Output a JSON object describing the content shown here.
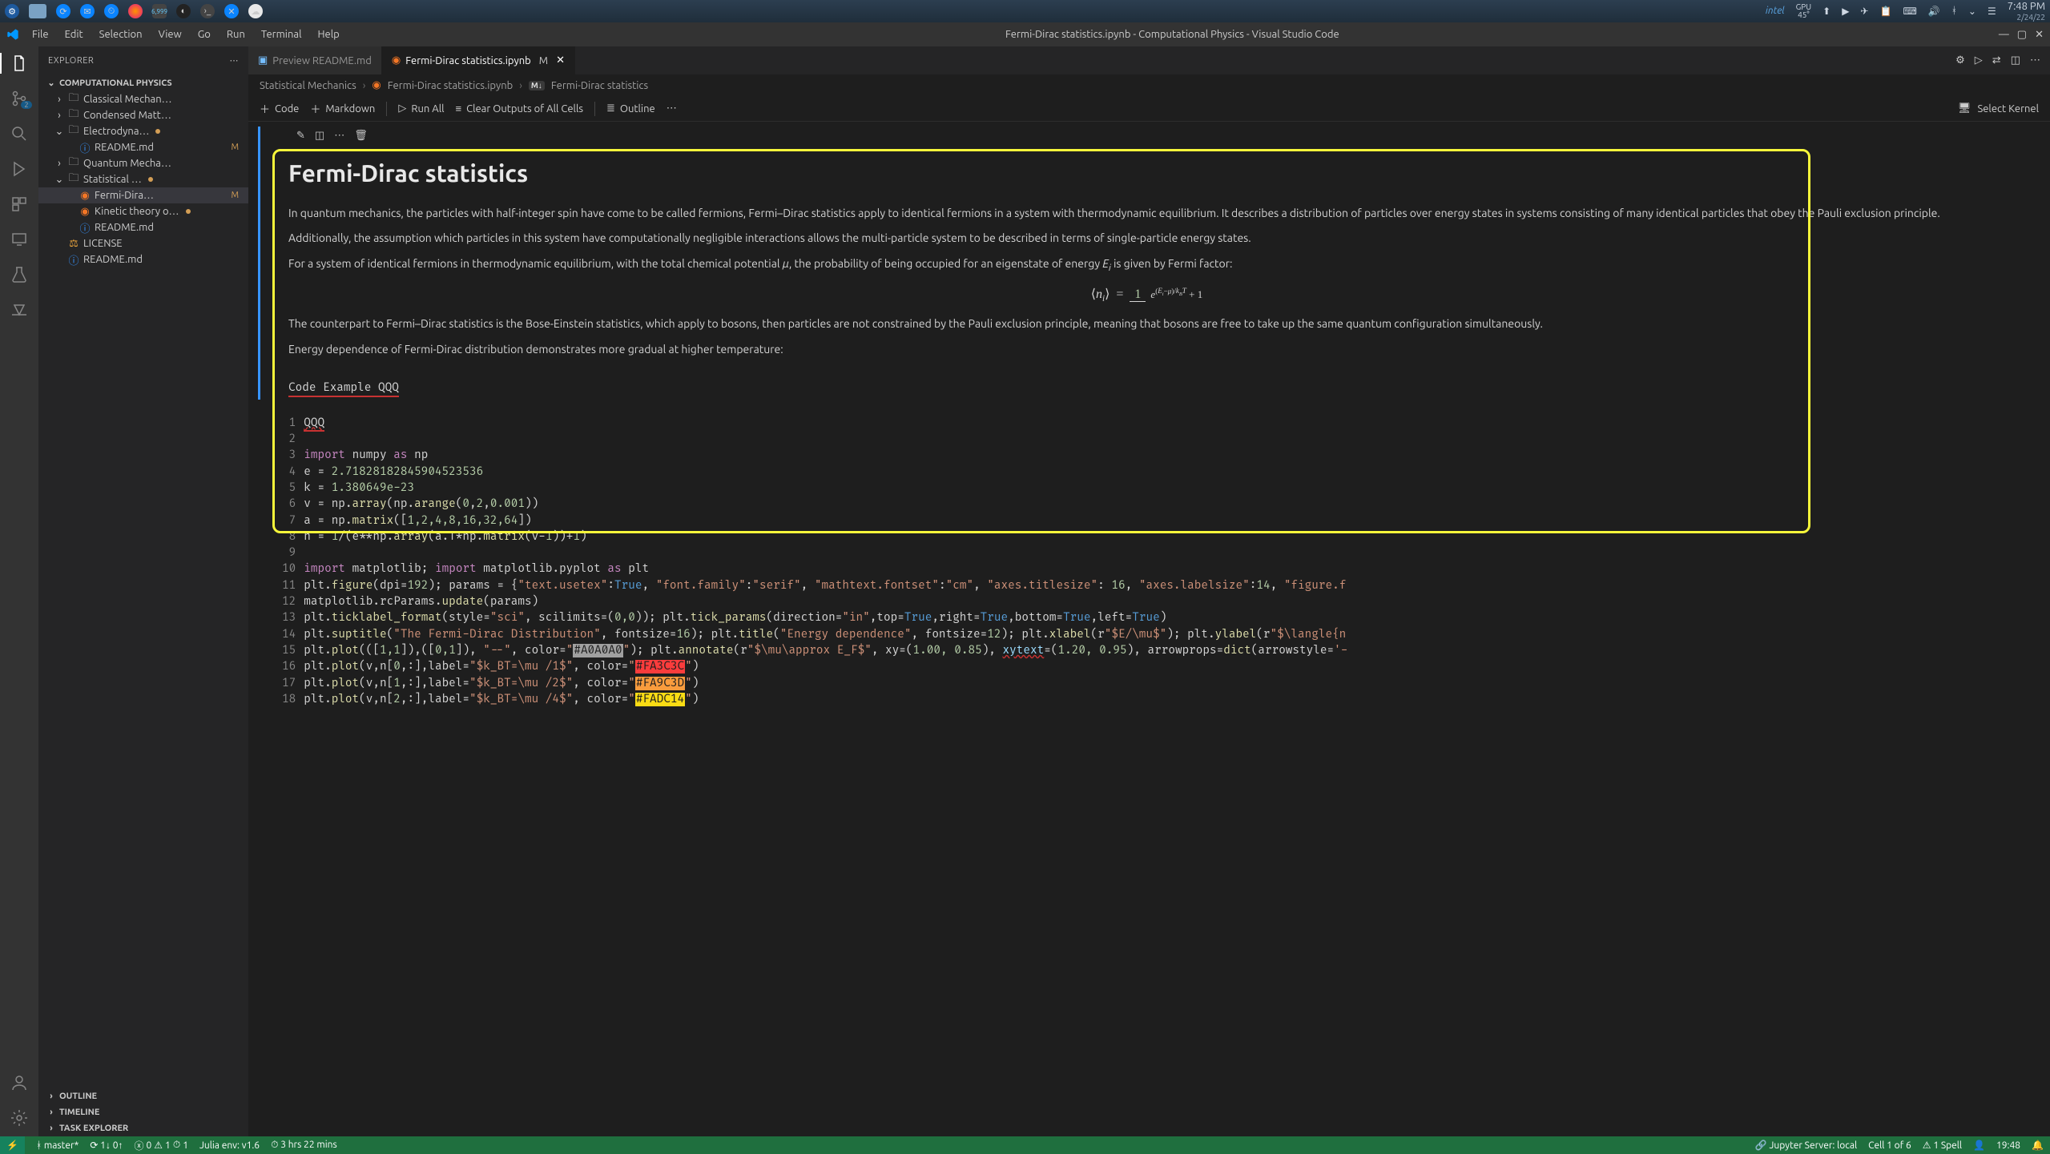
{
  "taskbar": {
    "gpu_label": "GPU",
    "gpu_temp": "45°",
    "intel": "intel",
    "time": "7:48 PM",
    "date": "2/24/22"
  },
  "titlebar": {
    "menus": [
      "File",
      "Edit",
      "Selection",
      "View",
      "Go",
      "Run",
      "Terminal",
      "Help"
    ],
    "title": "Fermi-Dirac statistics.ipynb - Computational Physics - Visual Studio Code"
  },
  "explorer": {
    "header": "EXPLORER",
    "project": "COMPUTATIONAL PHYSICS",
    "tree": [
      {
        "indent": 1,
        "type": "folder",
        "chev": "›",
        "name": "Classical Mechan…",
        "st": ""
      },
      {
        "indent": 1,
        "type": "folder",
        "chev": "›",
        "name": "Condensed Matt…",
        "st": ""
      },
      {
        "indent": 1,
        "type": "folder",
        "chev": "⌄",
        "name": "Electrodyna…",
        "st": "",
        "dot": true
      },
      {
        "indent": 2,
        "type": "info",
        "name": "README.md",
        "st": "M"
      },
      {
        "indent": 1,
        "type": "folder",
        "chev": "›",
        "name": "Quantum Mecha…",
        "st": ""
      },
      {
        "indent": 1,
        "type": "folder",
        "chev": "⌄",
        "name": "Statistical …",
        "st": "",
        "dot": true
      },
      {
        "indent": 2,
        "type": "jup",
        "name": "Fermi-Dira…",
        "st": "M",
        "sel": true
      },
      {
        "indent": 2,
        "type": "jup",
        "name": "Kinetic theory o…",
        "st": "",
        "dot": true
      },
      {
        "indent": 2,
        "type": "info",
        "name": "README.md",
        "st": ""
      },
      {
        "indent": 1,
        "type": "lic",
        "name": "LICENSE",
        "st": ""
      },
      {
        "indent": 1,
        "type": "info",
        "name": "README.md",
        "st": ""
      }
    ],
    "sections": [
      "OUTLINE",
      "TIMELINE",
      "TASK EXPLORER"
    ]
  },
  "tabs": [
    {
      "icon": "preview",
      "label": "Preview README.md",
      "active": false
    },
    {
      "icon": "jupyter",
      "label": "Fermi-Dirac statistics.ipynb",
      "mod": "M",
      "active": true,
      "close": true
    }
  ],
  "tab_actions": {},
  "breadcrumbs": {
    "folder": "Statistical Mechanics",
    "file": "Fermi-Dirac statistics.ipynb",
    "symtag": "M↓",
    "symbol": "Fermi-Dirac statistics"
  },
  "nb_toolbar": {
    "code": "Code",
    "markdown": "Markdown",
    "runall": "Run All",
    "clear": "Clear Outputs of All Cells",
    "outline": "Outline",
    "kernel": "Select Kernel"
  },
  "md": {
    "title": "Fermi-Dirac statistics",
    "p1": "In quantum mechanics, the particles with half-integer spin have come to be called fermions, Fermi–Dirac statistics apply to identical fermions in a system with thermodynamic equilibrium. It describes a distribution of particles over energy states in systems consisting of many identical particles that obey the Pauli exclusion principle.",
    "p2": "Additionally, the assumption which particles in this system have computationally negligible interactions allows the multi-particle system to be described in terms of single-particle energy states.",
    "p3a": "For a system of identical fermions in thermodynamic equilibrium, with the total chemical potential ",
    "p3b": ", the probability of being occupied for an eigenstate of energy ",
    "p3c": " is given by Fermi factor:",
    "p4": "The counterpart to Fermi–Dirac statistics is the Bose-Einstein statistics, which apply to bosons, then particles are not constrained by the Pauli exclusion principle, meaning that bosons are free to take up the same quantum configuration simultaneously.",
    "p5": "Energy dependence of Fermi-Dirac distribution demonstrates more gradual at higher temperature:",
    "code_label": "Code Example QQQ"
  },
  "code": {
    "lines": 18,
    "l1": "QQQ",
    "l3_import": "import",
    "l3_as": "as",
    "l3_numpy": "numpy",
    "l3_np": "np",
    "l4": "e = ",
    "l4v": "2.71828182845904523536",
    "l5": "k = ",
    "l5v": "1.380649e-23",
    "l6": "v = np.",
    "l6fn": "array",
    "l6a": "(np.",
    "l6fn2": "arange",
    "l6b": "(",
    "l6n1": "0",
    "l6n2": "2",
    "l6n3": "0.001",
    "l6c": "))",
    "l7": "a = np.",
    "l7fn": "matrix",
    "l7a": "([",
    "l7n": "1,2,4,8,16,32,64",
    "l7b": "])",
    "l8": "n = ",
    "l8a": "1",
    "l8b": "/(e**np.",
    "l8fn": "array",
    "l8c": "(a.T*np.",
    "l8fn2": "matrix",
    "l8d": "(v-",
    "l8n": "1",
    "l8e": "))+",
    "l8n2": "1",
    "l8f": ")",
    "l10a": "import",
    "l10b": "matplotlib;",
    "l10c": "import",
    "l10d": "matplotlib.pyplot",
    "l10e": "as",
    "l10f": "plt",
    "l11": "plt.",
    "l11fn": "figure",
    "l11a": "(dpi=",
    "l11n": "192",
    "l11b": "); params = {",
    "l11s1": "\"text.usetex\"",
    "l11c": ":",
    "l11t": "True",
    "l11d": ", ",
    "l11s2": "\"font.family\"",
    "l11e": ":",
    "l11s3": "\"serif\"",
    "l11f": ", ",
    "l11s4": "\"mathtext.fontset\"",
    "l11g": ":",
    "l11s5": "\"cm\"",
    "l11h": ", ",
    "l11s6": "\"axes.titlesize\"",
    "l11i": ": ",
    "l11n2": "16",
    "l11j": ", ",
    "l11s7": "\"axes.labelsize\"",
    "l11k": ":",
    "l11n3": "14",
    "l11l": ", ",
    "l11s8": "\"figure.f",
    "l12": "matplotlib.rcParams.",
    "l12fn": "update",
    "l12a": "(params)",
    "l13": "plt.",
    "l13fn": "ticklabel_format",
    "l13a": "(style=",
    "l13s": "\"sci\"",
    "l13b": ", scilimits=(",
    "l13n": "0,0",
    "l13c": ")); plt.",
    "l13fn2": "tick_params",
    "l13d": "(direction=",
    "l13s2": "\"in\"",
    "l13e": ",top=",
    "l13t": "True",
    "l13f": ",right=",
    "l13g": ",bottom=",
    "l13h": ",left=",
    "l13i": ")",
    "l14": "plt.",
    "l14fn": "suptitle",
    "l14a": "(",
    "l14s": "\"The Fermi-Dirac Distribution\"",
    "l14b": ", fontsize=",
    "l14n": "16",
    "l14c": "); plt.",
    "l14fn2": "title",
    "l14d": "(",
    "l14s2": "\"Energy dependence\"",
    "l14e": ", fontsize=",
    "l14n2": "12",
    "l14f": "); plt.",
    "l14fn3": "xlabel",
    "l14g": "(r",
    "l14s3": "\"$E/\\mu$\"",
    "l14h": "); plt.",
    "l14fn4": "ylabel",
    "l14i": "(r",
    "l14s4": "\"$\\langle{n",
    "l15": "plt.",
    "l15fn": "plot",
    "l15a": "(([",
    "l15n": "1,1",
    "l15b": "]),([",
    "l15n2": "0,1",
    "l15c": "]), ",
    "l15s": "\"--\"",
    "l15d": ", color=",
    "l15cq": "\"",
    "l15col": "#A0A0A0",
    "l15cq2": "\"",
    "l15e": "); plt.",
    "l15fn2": "annotate",
    "l15f": "(r",
    "l15s2": "\"$\\mu\\approx E_F$\"",
    "l15g": ", xy=(",
    "l15n3": "1.00, 0.85",
    "l15h": "), ",
    "l15xy": "xytext",
    "l15i": "=(",
    "l15n4": "1.20, 0.95",
    "l15j": "), arrowprops=",
    "l15fn3": "dict",
    "l15k": "(arrowstyle=",
    "l15s3": "'-",
    "l16": "plt.",
    "l16fn": "plot",
    "l16a": "(v,n[",
    "l16n": "0",
    "l16b": ",:],label=",
    "l16s": "\"$k_BT=\\mu /1$\"",
    "l16c": ", color=",
    "l16cq": "\"",
    "l16col": "#FA3C3C",
    "l16cq2": "\"",
    "l16d": ")",
    "l17": "plt.",
    "l17fn": "plot",
    "l17a": "(v,n[",
    "l17n": "1",
    "l17b": ",:],label=",
    "l17s": "\"$k_BT=\\mu /2$\"",
    "l17c": ", color=",
    "l17cq": "\"",
    "l17col": "#FA9C3D",
    "l17cq2": "\"",
    "l17d": ")",
    "l18": "plt.",
    "l18fn": "plot",
    "l18a": "(v,n[",
    "l18n": "2",
    "l18b": ",:],label=",
    "l18s": "\"$k_BT=\\mu /4$\"",
    "l18c": ", color=",
    "l18cq": "\"",
    "l18col": "#FADC14",
    "l18cq2": "\"",
    "l18d": ")"
  },
  "status": {
    "branch": "master*",
    "sync": "1↓ 0↑",
    "errors": "0",
    "warnings": "1",
    "clock": "1",
    "julia": "Julia env: v1.6",
    "elapsed": "3 hrs 22 mins",
    "jupyter": "Jupyter Server: local",
    "cell": "Cell 1 of 6",
    "spell": "1 Spell",
    "time": "19:48"
  },
  "scm_badge": "2"
}
